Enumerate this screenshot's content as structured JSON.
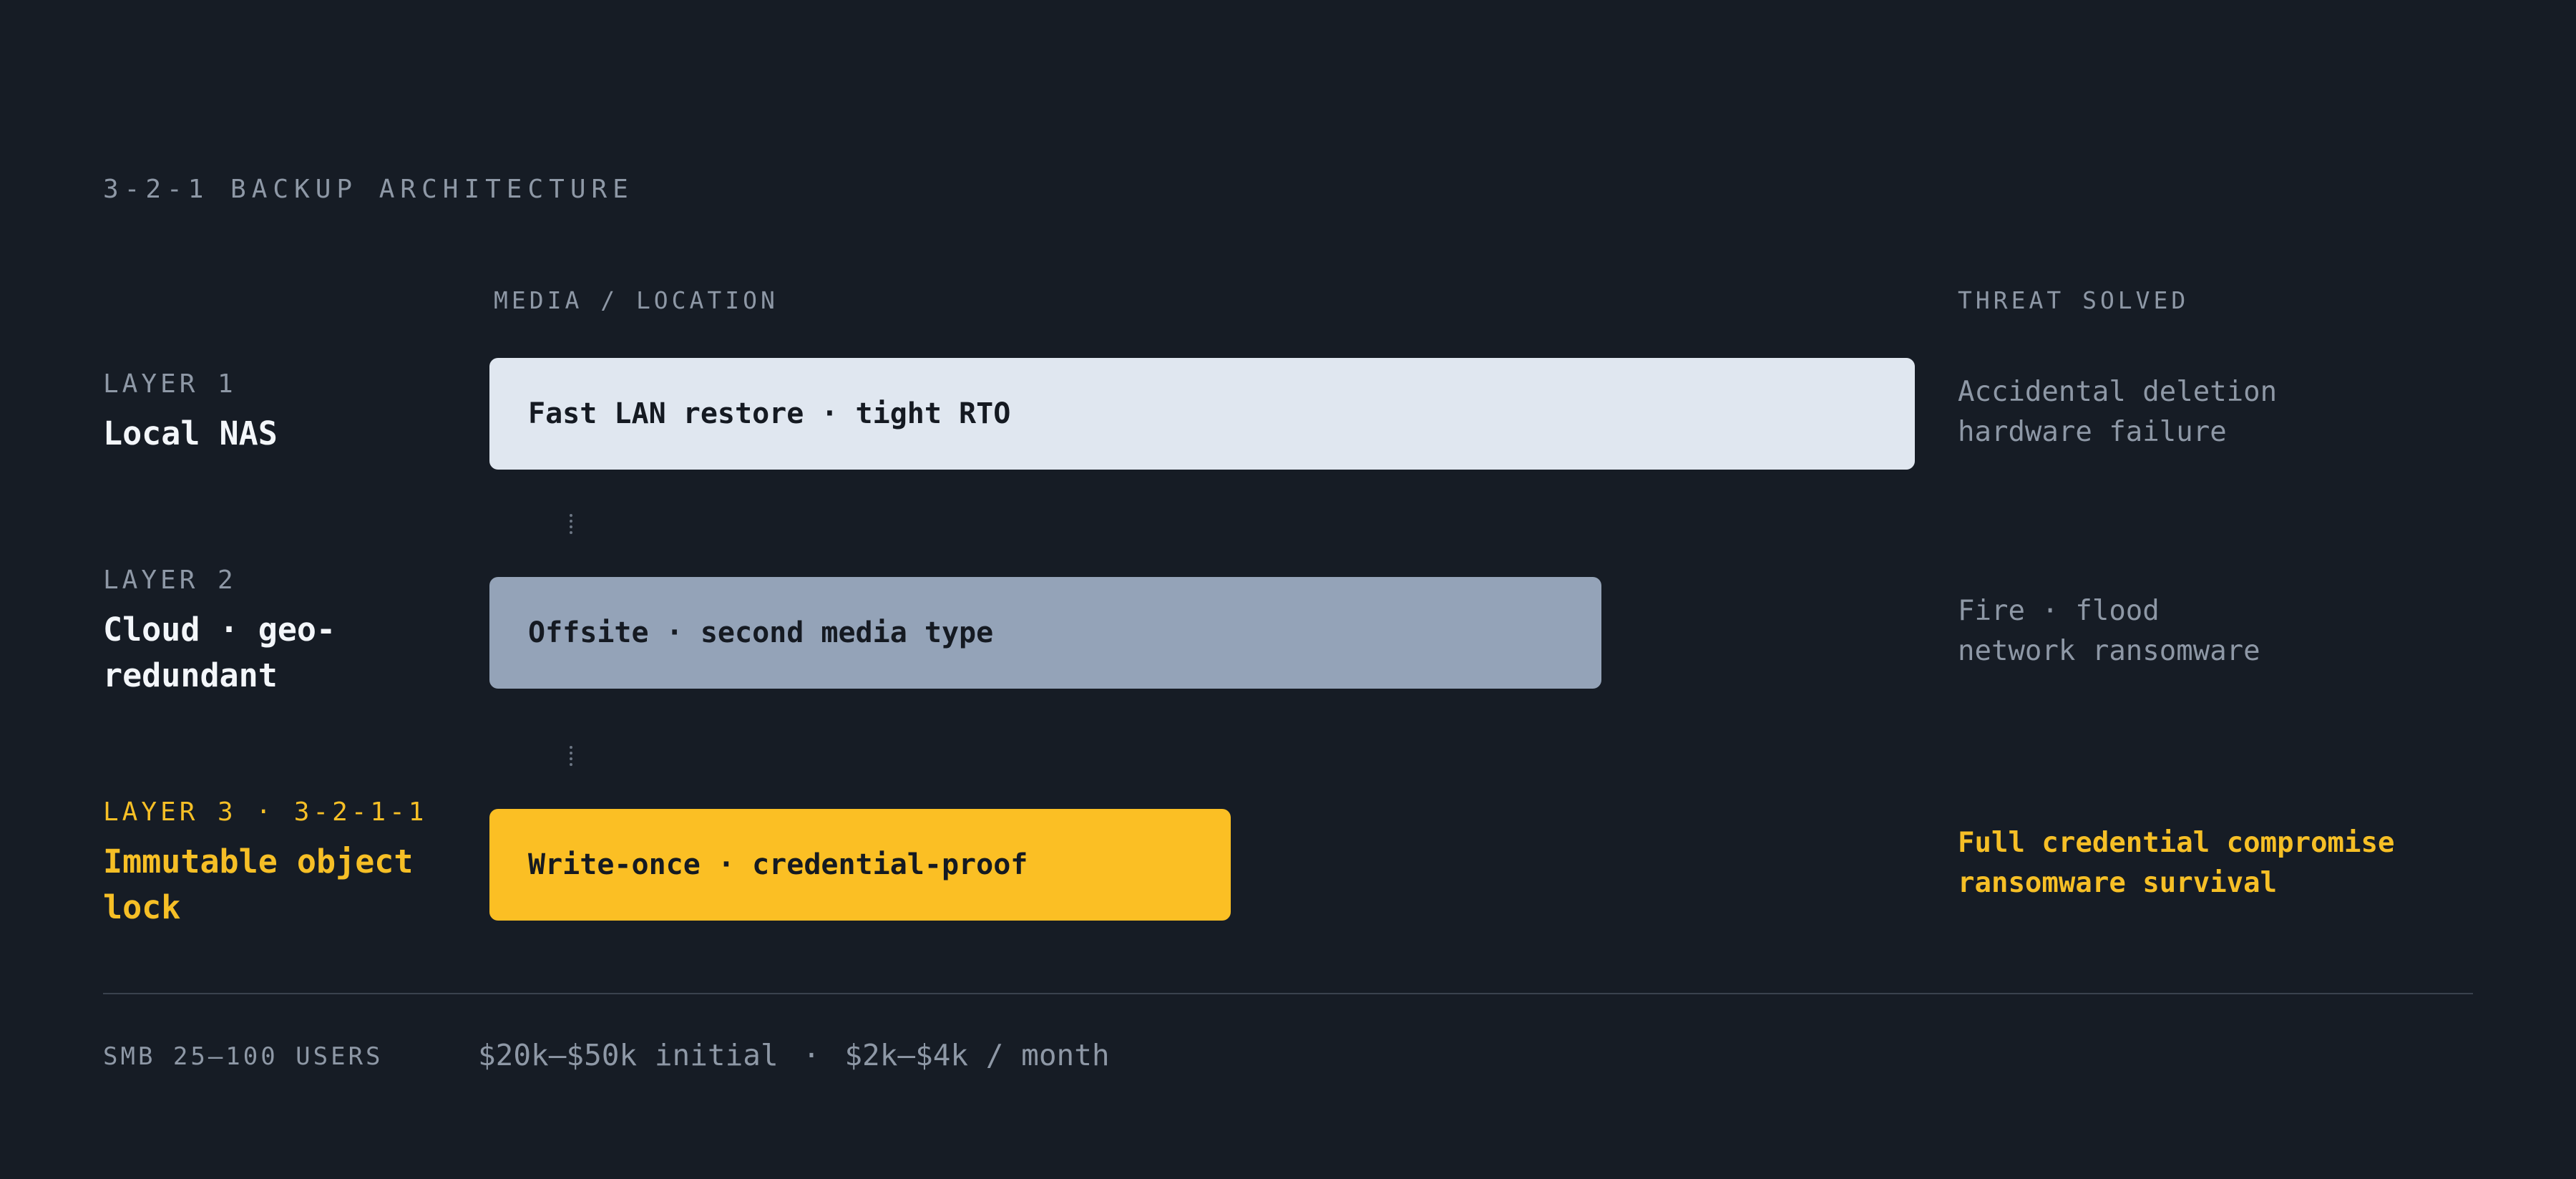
{
  "title": "3-2-1 BACKUP ARCHITECTURE",
  "columns": {
    "media": "MEDIA / LOCATION",
    "threat": "THREAT SOLVED"
  },
  "layers": [
    {
      "tag": "LAYER 1",
      "name": "Local NAS",
      "bar_label": "Fast LAN restore · tight RTO",
      "bar_fill": 1.0,
      "threat": [
        "Accidental deletion",
        "hardware failure"
      ]
    },
    {
      "tag": "LAYER 2",
      "name": "Cloud · geo-redundant",
      "bar_label": "Offsite · second media type",
      "bar_fill": 0.78,
      "threat": [
        "Fire · flood",
        "network ransomware"
      ]
    },
    {
      "tag": "LAYER 3 · 3-2-1-1",
      "name": "Immutable object lock",
      "bar_label": "Write-once · credential-proof",
      "bar_fill": 0.52,
      "threat": [
        "Full credential compromise",
        "ransomware survival"
      ]
    }
  ],
  "footer": {
    "segment": "SMB 25–100 USERS",
    "initial_cost": "$20k–$50k initial",
    "separator": "·",
    "monthly_cost": "$2k–$4k / month"
  },
  "colors": {
    "background": "#161c25",
    "layer1_bar": "#e0e7f0",
    "layer2_bar": "#94a3b8",
    "layer3_bar": "#fbbf24",
    "accent": "#f6bf26",
    "muted_text": "#8e98a6"
  }
}
